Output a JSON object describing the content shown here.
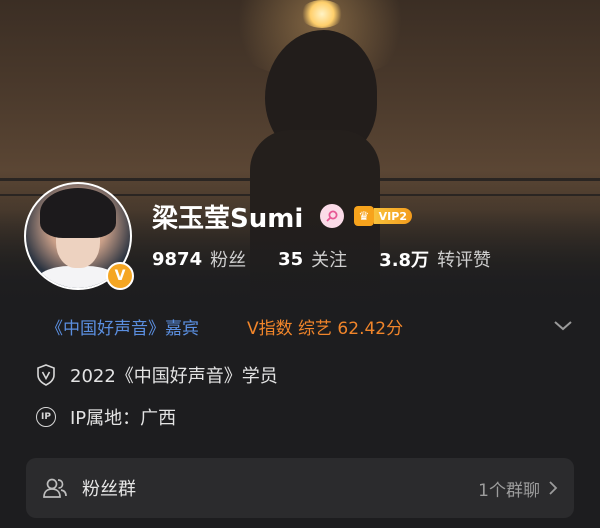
{
  "profile": {
    "name": "梁玉莹Sumi",
    "gender_icon": "female-icon",
    "vip_level": "VIP2",
    "verified_badge": "V",
    "stats": [
      {
        "value": "9874",
        "label": "粉丝"
      },
      {
        "value": "35",
        "label": "关注"
      },
      {
        "value": "3.8万",
        "label": "转评赞"
      }
    ]
  },
  "tags": {
    "guest": "《中国好声音》嘉宾",
    "v_index": "V指数 综艺 62.42分"
  },
  "info": {
    "identity": "2022《中国好声音》学员",
    "ip_location": "IP属地：广西"
  },
  "fans_group": {
    "title": "粉丝群",
    "count": "1个群聊"
  },
  "colors": {
    "background": "#1d1d1f",
    "link_blue": "#5b8fe0",
    "v_index_orange": "#f1852a",
    "verified_orange": "#f5a623",
    "card_bg": "#2b2b2d"
  }
}
